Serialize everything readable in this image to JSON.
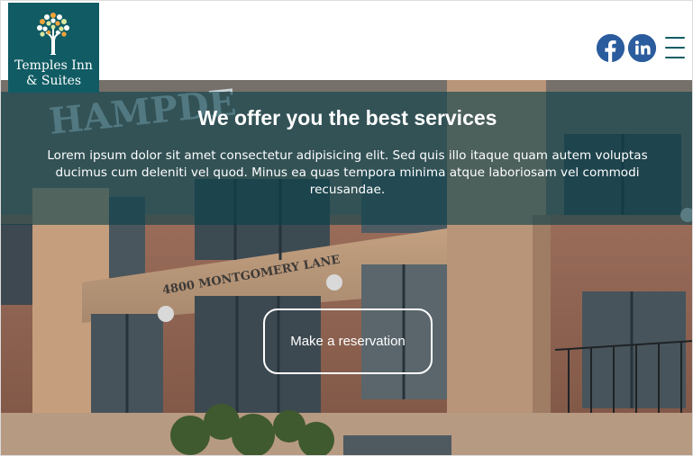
{
  "brand": {
    "name_line1": "Temples Inn",
    "name_line2": "& Suites",
    "tile_color": "#115c64"
  },
  "header": {
    "icons": [
      "facebook-icon",
      "linkedin-icon",
      "hamburger-menu-icon"
    ],
    "social_color": "#2b5c9e"
  },
  "hero": {
    "title": "We offer you the best services",
    "body": "Lorem ipsum dolor sit amet consectetur adipisicing elit. Sed quis illo itaque quam autem voluptas ducimus cum deleniti vel quod. Minus ea quas tempora minima atque laboriosam vel commodi recusandae.",
    "cta_label": "Make a reservation",
    "building_sign": "HAMPDE",
    "street_sign": "4800 MONTGOMERY LANE",
    "banner_color": "#0a414b"
  }
}
